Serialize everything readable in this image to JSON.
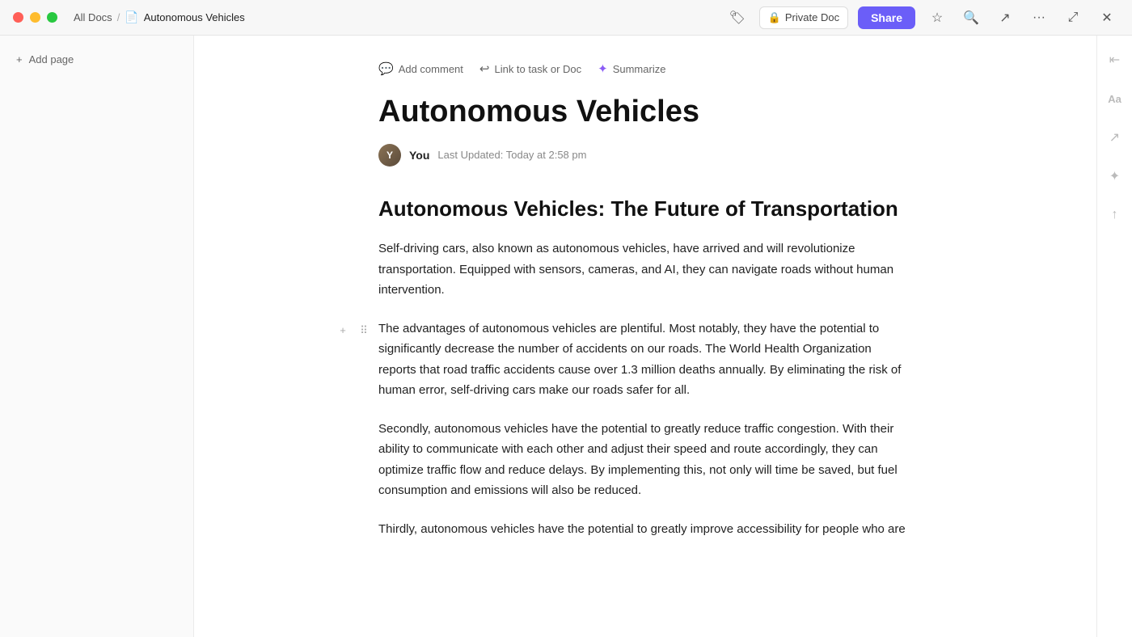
{
  "titlebar": {
    "all_docs_label": "All Docs",
    "separator": "/",
    "doc_name": "Autonomous Vehicles",
    "private_doc_label": "Private Doc",
    "share_label": "Share"
  },
  "toolbar": {
    "add_comment_label": "Add comment",
    "link_to_task_label": "Link to task or Doc",
    "summarize_label": "Summarize"
  },
  "sidebar": {
    "add_page_label": "Add page"
  },
  "doc": {
    "title": "Autonomous Vehicles",
    "author": "You",
    "last_updated": "Last Updated: Today at 2:58 pm",
    "heading": "Autonomous Vehicles: The Future of Transportation",
    "paragraph1": "Self-driving cars, also known as autonomous vehicles, have arrived and will revolutionize transportation. Equipped with sensors, cameras, and AI, they can navigate roads without human intervention.",
    "paragraph2": "The advantages of autonomous vehicles are plentiful. Most notably, they have the potential to significantly decrease the number of accidents on our roads. The World Health Organization reports that road traffic accidents cause over 1.3 million deaths annually. By eliminating the risk of human error, self-driving cars make our roads safer for all.",
    "paragraph3": "Secondly, autonomous vehicles have the potential to greatly reduce traffic congestion. With their ability to communicate with each other and adjust their speed and route accordingly, they can optimize traffic flow and reduce delays. By implementing this, not only will time be saved, but fuel consumption and emissions will also be reduced.",
    "paragraph4": "Thirdly, autonomous vehicles have the potential to greatly improve accessibility for people who are"
  }
}
